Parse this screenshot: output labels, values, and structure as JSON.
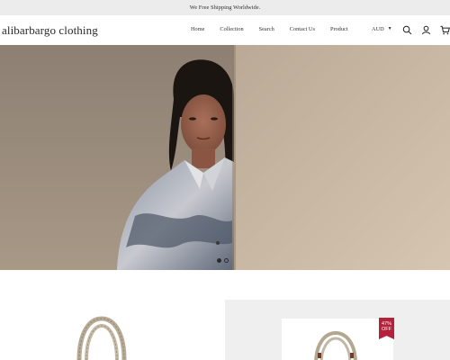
{
  "announcement": "We Free Shipping Worldwide.",
  "header": {
    "logo": "alibarbargo clothing",
    "nav": [
      "Home",
      "Collection",
      "Search",
      "Contact Us",
      "Product"
    ],
    "currency": "AUD",
    "icons": [
      "search-icon",
      "account-icon",
      "cart-icon"
    ]
  },
  "hero": {
    "slide_count": 2,
    "active_slide": 1
  },
  "products": {
    "discount_badge": [
      "47%",
      "OFF"
    ]
  },
  "colors": {
    "announce_bg": "#ececec",
    "badge": "#b5213a",
    "product_bg": "#efefef"
  }
}
